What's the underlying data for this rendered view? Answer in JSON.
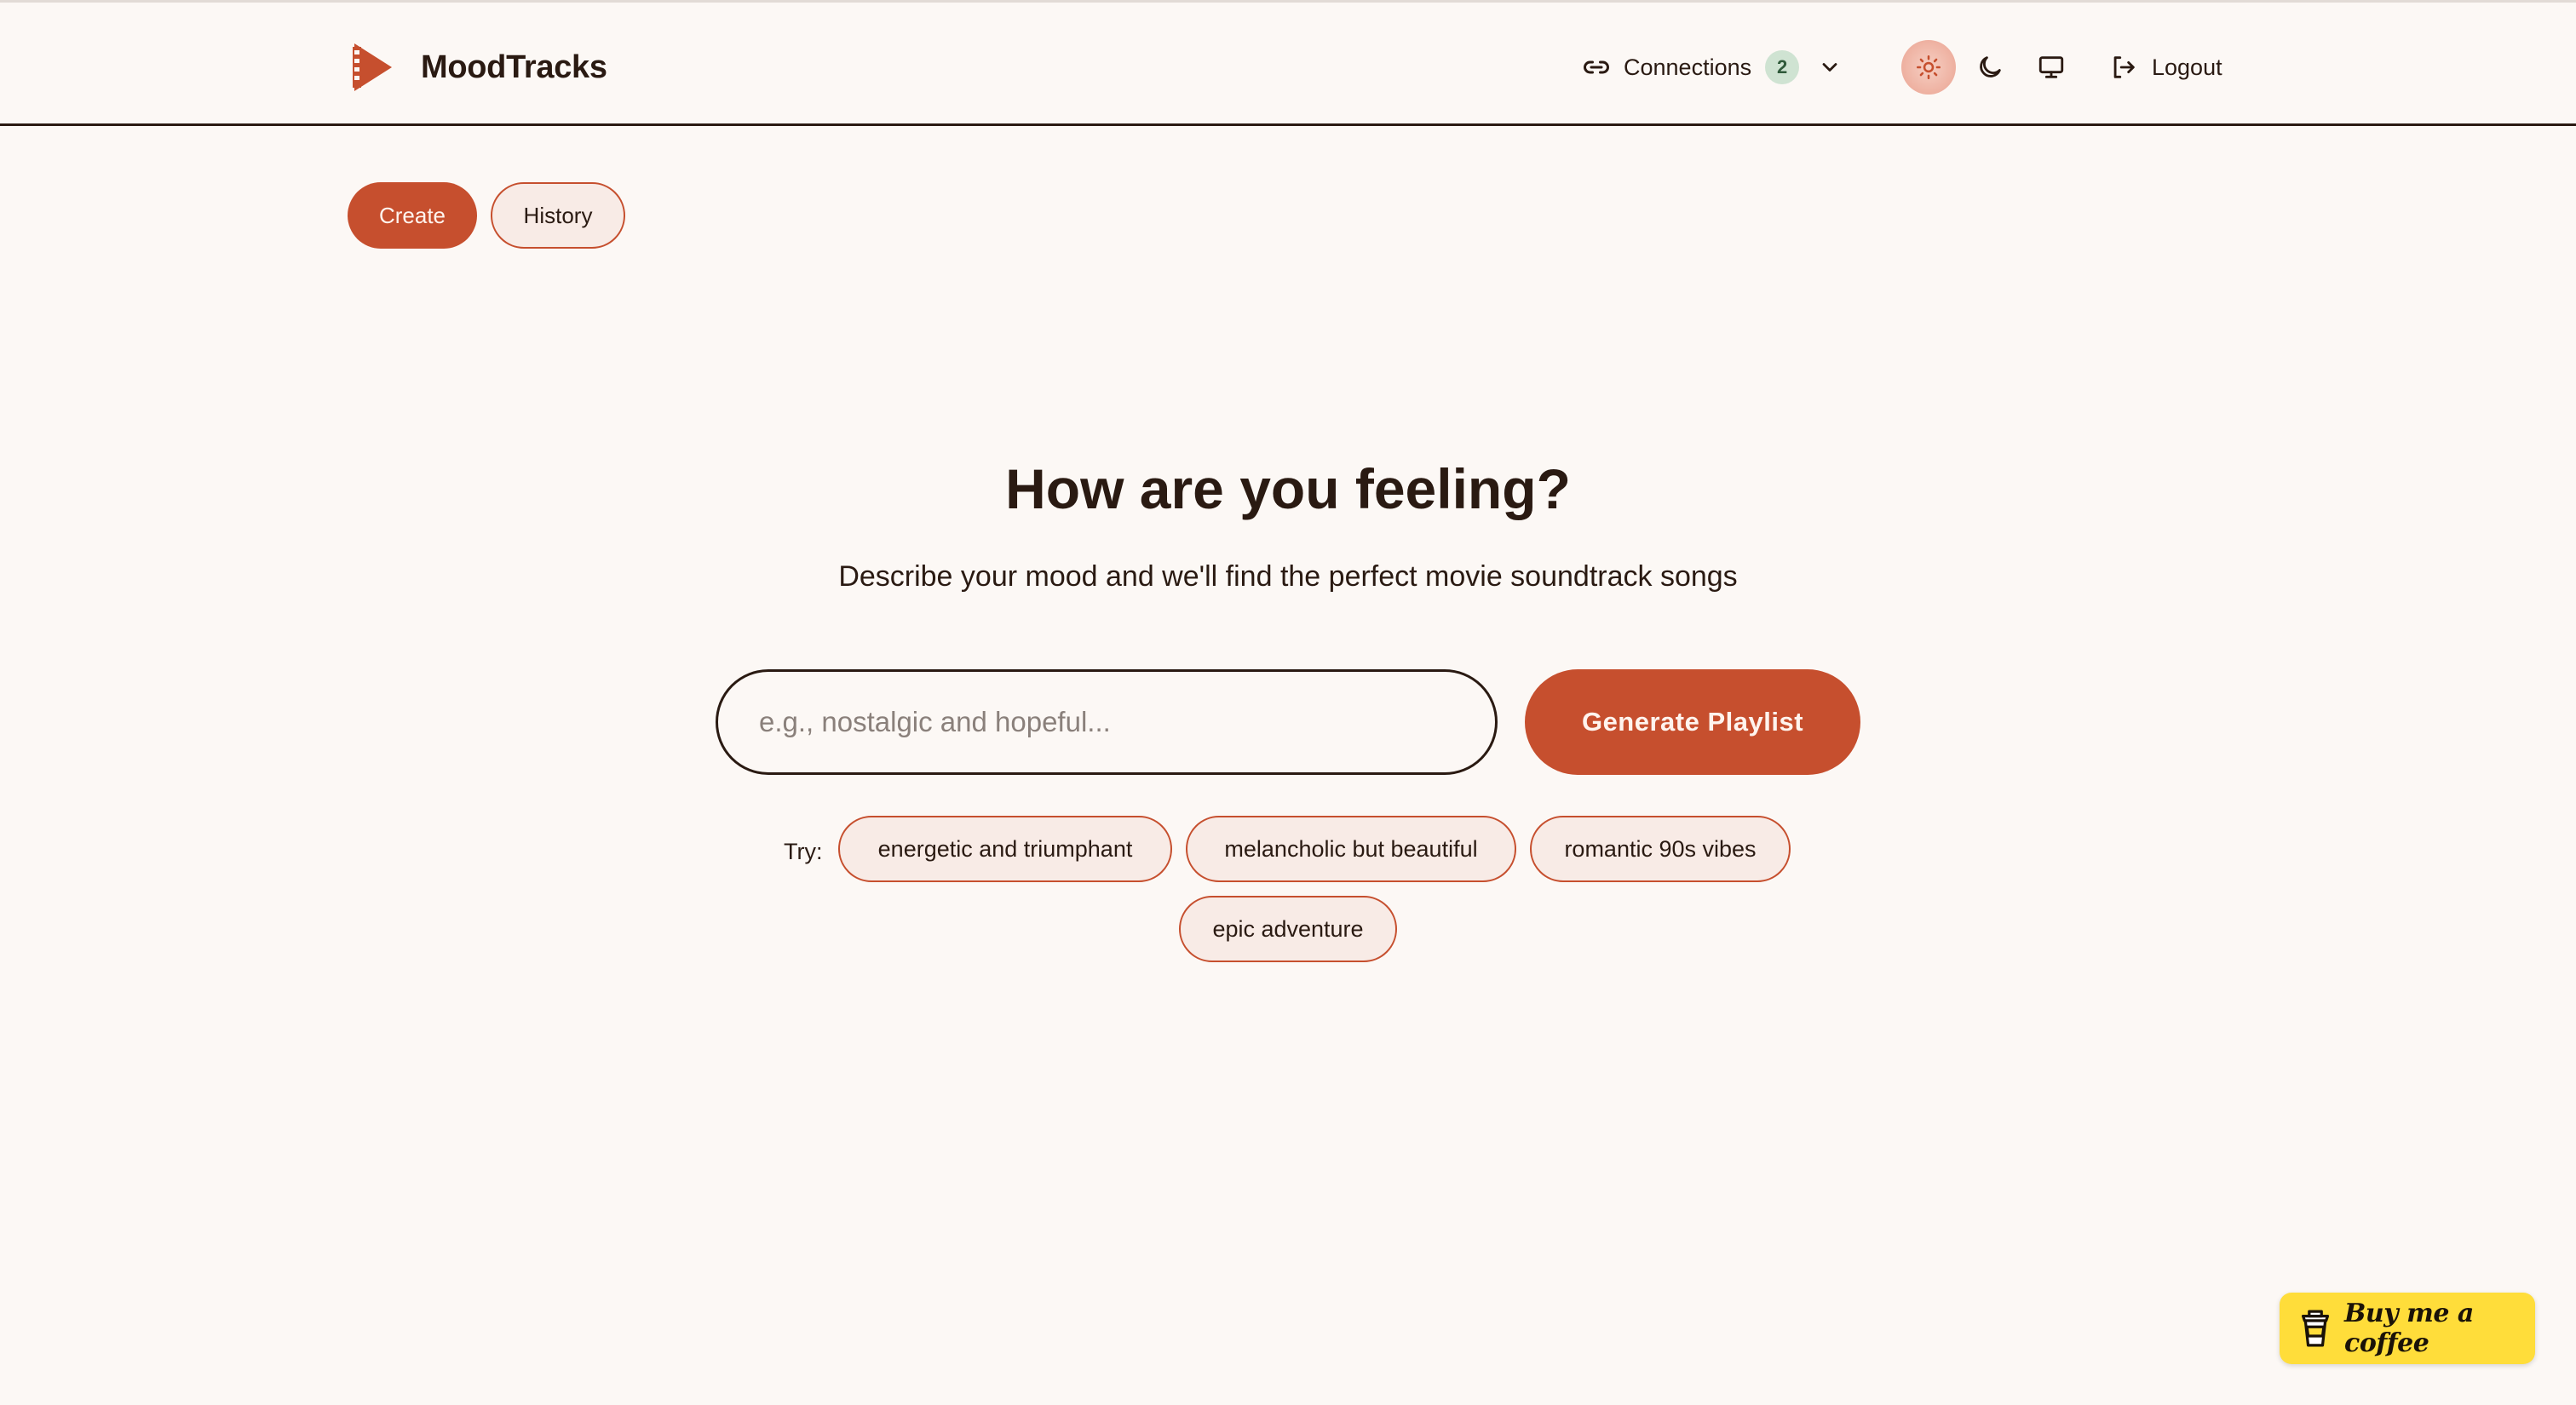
{
  "brand": {
    "name": "MoodTracks",
    "logo_icon": "film-play-logo-icon"
  },
  "header": {
    "connections": {
      "label": "Connections",
      "count": "2"
    },
    "theme": {
      "light": "sun-icon",
      "dark": "moon-icon",
      "system": "monitor-icon",
      "active": "light"
    },
    "logout_label": "Logout"
  },
  "tabs": [
    {
      "label": "Create",
      "active": true
    },
    {
      "label": "History",
      "active": false
    }
  ],
  "hero": {
    "title": "How are you feeling?",
    "subtitle": "Describe your mood and we'll find the perfect movie soundtrack songs"
  },
  "mood_input": {
    "placeholder": "e.g., nostalgic and hopeful...",
    "value": ""
  },
  "generate_button": "Generate Playlist",
  "suggestions": {
    "label": "Try:",
    "items": [
      "energetic and triumphant",
      "melancholic but beautiful",
      "romantic 90s vibes",
      "epic adventure"
    ]
  },
  "buy_me_a_coffee": "Buy me a coffee",
  "colors": {
    "accent": "#c64f2e",
    "background": "#fcf8f5",
    "text": "#2a1a12",
    "chip_background": "#f8ebe6",
    "badge_background": "#cfe3d2",
    "coffee_yellow": "#ffdd3a"
  }
}
